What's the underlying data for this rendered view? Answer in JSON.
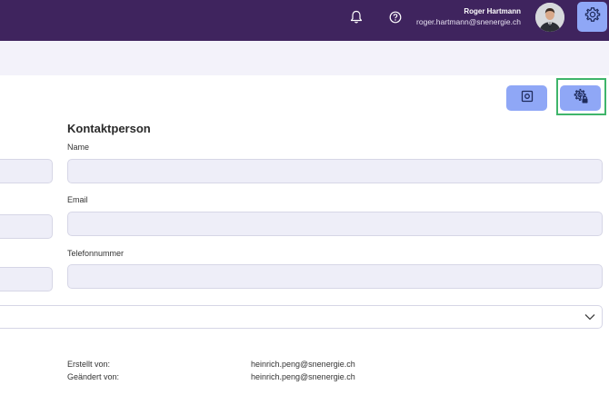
{
  "header": {
    "user_name": "Roger Hartmann",
    "user_email": "roger.hartmann@snenergie.ch",
    "icons": [
      "bell-icon",
      "help-icon",
      "avatar",
      "gear-icon"
    ]
  },
  "toolbar": {
    "icons": [
      "preview-icon",
      "gear-lock-icon"
    ]
  },
  "contact": {
    "title": "Kontaktperson",
    "name_label": "Name",
    "name_value": "",
    "email_label": "Email",
    "email_value": "",
    "phone_label": "Telefonnummer",
    "phone_value": ""
  },
  "meta": {
    "created_label": "Erstellt von:",
    "created_value": "heinrich.peng@snenergie.ch",
    "changed_label": "Geändert von:",
    "changed_value": "heinrich.peng@snenergie.ch"
  },
  "colors": {
    "header_bg": "#3f245e",
    "accent": "#8fa7f6",
    "highlight": "#3fb56a"
  }
}
